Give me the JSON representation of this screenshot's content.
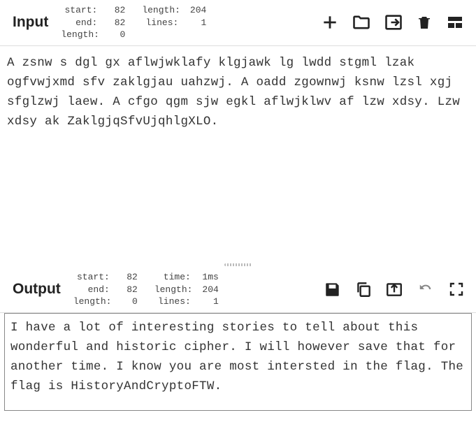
{
  "input": {
    "title": "Input",
    "stats": {
      "start_label": "start:",
      "start_value": "82",
      "end_label": "end:",
      "end_value": "82",
      "length_label": "length:",
      "length_value": "0",
      "length2_label": "length:",
      "length2_value": "204",
      "lines_label": "lines:",
      "lines_value": "1"
    },
    "body": "A zsnw s dgl gx aflwjwklafy klgjawk lg lwdd stgml lzak ogfvwjxmd sfv zaklgjau uahzwj. A oadd zgownwj ksnw lzsl xgj sfglzwj laew. A cfgo qgm sjw egkl aflwjklwv af lzw xdsy. Lzw xdsy ak ZaklgjqSfvUjqhlgXLO."
  },
  "output": {
    "title": "Output",
    "stats": {
      "start_label": "start:",
      "start_value": "82",
      "end_label": "end:",
      "end_value": "82",
      "length_label": "length:",
      "length_value": "0",
      "time_label": "time:",
      "time_value": "1ms",
      "length2_label": "length:",
      "length2_value": "204",
      "lines_label": "lines:",
      "lines_value": "1"
    },
    "body": "I have a lot of interesting stories to tell about this wonderful and historic cipher. I will however save that for another time. I know you are most intersted in the flag. The flag is HistoryAndCryptoFTW."
  }
}
